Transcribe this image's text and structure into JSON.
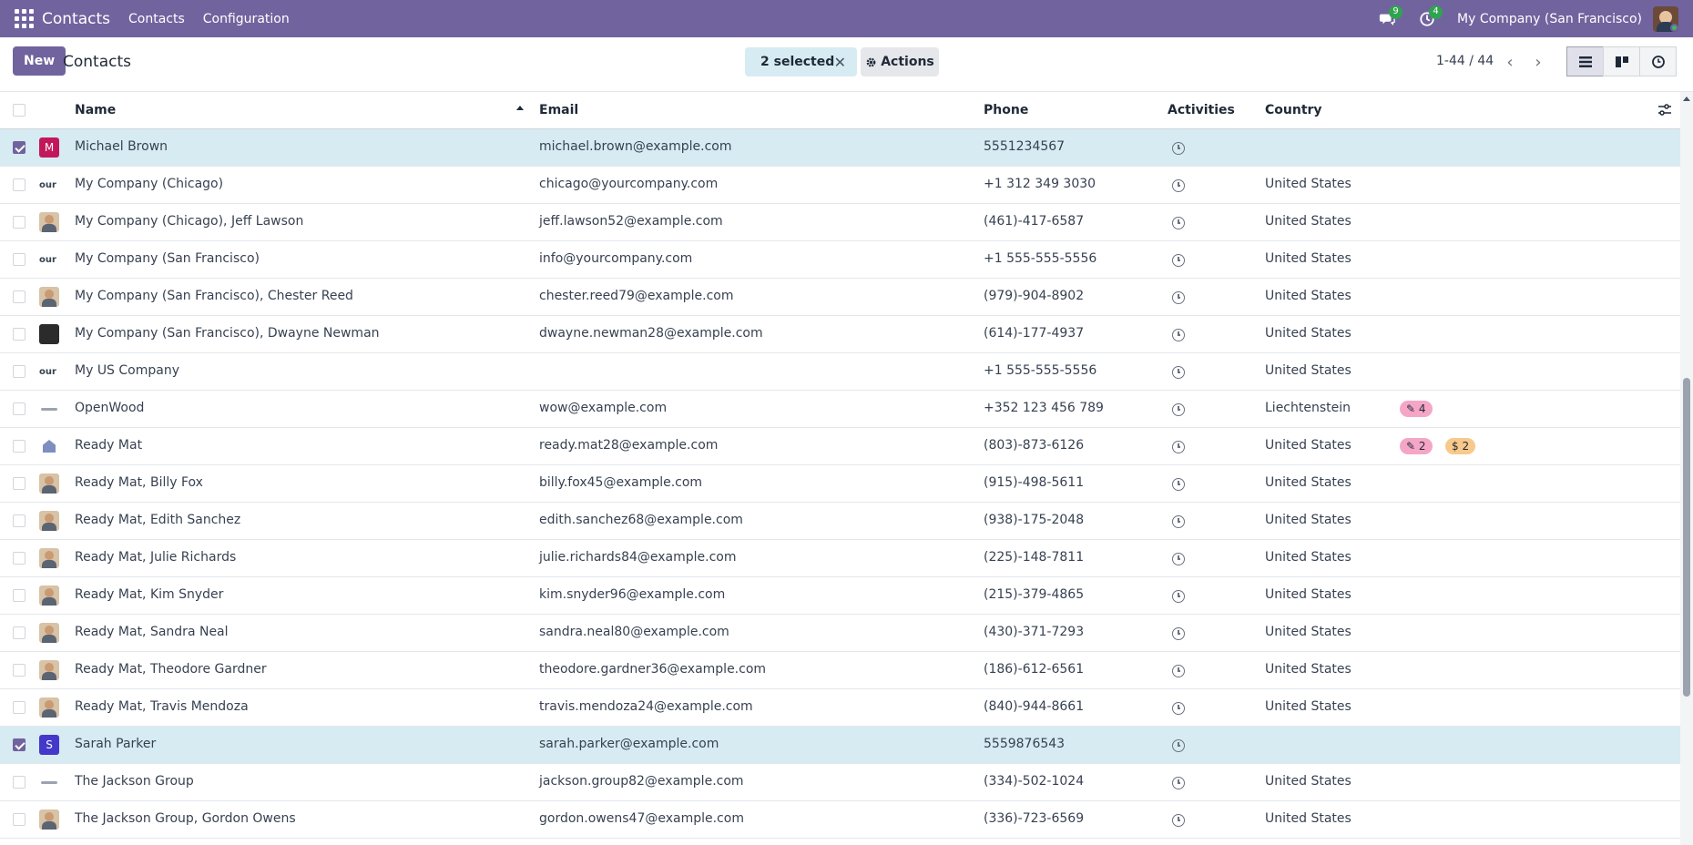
{
  "navbar": {
    "app_name": "Contacts",
    "menu": [
      "Contacts",
      "Configuration"
    ],
    "messages_count": "9",
    "activities_count": "4",
    "company": "My Company (San Francisco)"
  },
  "control_panel": {
    "new_label": "New",
    "title": "Contacts",
    "selected_label": "2 selected",
    "actions_label": "Actions",
    "pager": "1-44 / 44"
  },
  "columns": {
    "name": "Name",
    "email": "Email",
    "phone": "Phone",
    "activities": "Activities",
    "country": "Country"
  },
  "rows": [
    {
      "selected": true,
      "avatar": "M",
      "name": "Michael Brown",
      "email": "michael.brown@example.com",
      "phone": "5551234567",
      "country": "",
      "tags": []
    },
    {
      "selected": false,
      "avatar": "our",
      "name": "My Company (Chicago)",
      "email": "chicago@yourcompany.com",
      "phone": "+1 312 349 3030",
      "country": "United States",
      "tags": []
    },
    {
      "selected": false,
      "avatar": "",
      "name": "My Company (Chicago), Jeff Lawson",
      "email": "jeff.lawson52@example.com",
      "phone": "(461)-417-6587",
      "country": "United States",
      "tags": []
    },
    {
      "selected": false,
      "avatar": "our",
      "name": "My Company (San Francisco)",
      "email": "info@yourcompany.com",
      "phone": "+1 555-555-5556",
      "country": "United States",
      "tags": []
    },
    {
      "selected": false,
      "avatar": "",
      "name": "My Company (San Francisco), Chester Reed",
      "email": "chester.reed79@example.com",
      "phone": "(979)-904-8902",
      "country": "United States",
      "tags": []
    },
    {
      "selected": false,
      "avatar": "",
      "name": "My Company (San Francisco), Dwayne Newman",
      "email": "dwayne.newman28@example.com",
      "phone": "(614)-177-4937",
      "country": "United States",
      "tags": []
    },
    {
      "selected": false,
      "avatar": "our",
      "name": "My US Company",
      "email": "",
      "phone": "+1 555-555-5556",
      "country": "United States",
      "tags": []
    },
    {
      "selected": false,
      "avatar": "",
      "name": "OpenWood",
      "email": "wow@example.com",
      "phone": "+352 123 456 789",
      "country": "Liechtenstein",
      "tags": [
        {
          "text": "4",
          "icon": "edit-icon",
          "color": "#f5a6c6"
        }
      ]
    },
    {
      "selected": false,
      "avatar": "",
      "name": "Ready Mat",
      "email": "ready.mat28@example.com",
      "phone": "(803)-873-6126",
      "country": "United States",
      "tags": [
        {
          "text": "2",
          "icon": "edit-icon",
          "color": "#f5a6c6"
        },
        {
          "text": "2",
          "icon": "dollar-icon",
          "color": "#f7c98b"
        }
      ]
    },
    {
      "selected": false,
      "avatar": "",
      "name": "Ready Mat, Billy Fox",
      "email": "billy.fox45@example.com",
      "phone": "(915)-498-5611",
      "country": "United States",
      "tags": []
    },
    {
      "selected": false,
      "avatar": "",
      "name": "Ready Mat, Edith Sanchez",
      "email": "edith.sanchez68@example.com",
      "phone": "(938)-175-2048",
      "country": "United States",
      "tags": []
    },
    {
      "selected": false,
      "avatar": "",
      "name": "Ready Mat, Julie Richards",
      "email": "julie.richards84@example.com",
      "phone": "(225)-148-7811",
      "country": "United States",
      "tags": []
    },
    {
      "selected": false,
      "avatar": "",
      "name": "Ready Mat, Kim Snyder",
      "email": "kim.snyder96@example.com",
      "phone": "(215)-379-4865",
      "country": "United States",
      "tags": []
    },
    {
      "selected": false,
      "avatar": "",
      "name": "Ready Mat, Sandra Neal",
      "email": "sandra.neal80@example.com",
      "phone": "(430)-371-7293",
      "country": "United States",
      "tags": []
    },
    {
      "selected": false,
      "avatar": "",
      "name": "Ready Mat, Theodore Gardner",
      "email": "theodore.gardner36@example.com",
      "phone": "(186)-612-6561",
      "country": "United States",
      "tags": []
    },
    {
      "selected": false,
      "avatar": "",
      "name": "Ready Mat, Travis Mendoza",
      "email": "travis.mendoza24@example.com",
      "phone": "(840)-944-8661",
      "country": "United States",
      "tags": []
    },
    {
      "selected": true,
      "avatar": "S",
      "name": "Sarah Parker",
      "email": "sarah.parker@example.com",
      "phone": "5559876543",
      "country": "",
      "tags": []
    },
    {
      "selected": false,
      "avatar": "",
      "name": "The Jackson Group",
      "email": "jackson.group82@example.com",
      "phone": "(334)-502-1024",
      "country": "United States",
      "tags": []
    },
    {
      "selected": false,
      "avatar": "",
      "name": "The Jackson Group, Gordon Owens",
      "email": "gordon.owens47@example.com",
      "phone": "(336)-723-6569",
      "country": "United States",
      "tags": []
    }
  ],
  "colors": {
    "navbar": "#71639e",
    "selected_row": "#d7ebf2",
    "activity_tag": "#f5a6c6",
    "sale_tag": "#f7c98b"
  }
}
